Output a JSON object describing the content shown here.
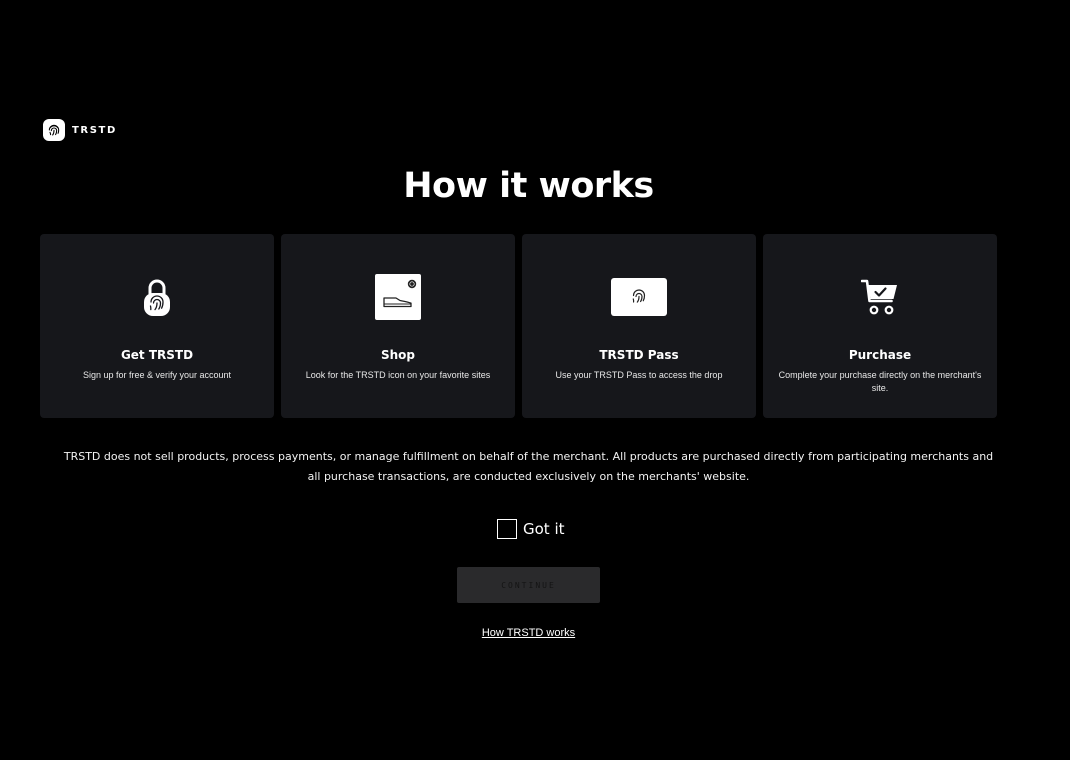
{
  "brand": {
    "name": "TRSTD",
    "icon": "fingerprint-icon"
  },
  "title": "How it works",
  "cards": [
    {
      "title": "Get TRSTD",
      "desc": "Sign up for free & verify your account",
      "icon": "fingerprint-lock-icon"
    },
    {
      "title": "Shop",
      "desc": "Look for the TRSTD icon on your favorite sites",
      "icon": "product-card-icon"
    },
    {
      "title": "TRSTD Pass",
      "desc": "Use your TRSTD Pass to access the drop",
      "icon": "pass-card-icon"
    },
    {
      "title": "Purchase",
      "desc": "Complete your purchase directly on the merchant's site.",
      "icon": "shopping-cart-check-icon"
    }
  ],
  "disclaimer": "TRSTD does not sell products, process payments, or manage fulfillment on behalf of the merchant. All products are purchased directly from participating merchants and all purchase transactions, are conducted exclusively on the merchants' website.",
  "confirm": {
    "label": "Got it",
    "checked": false
  },
  "continue_label": "CONTINUE",
  "how_link": "How TRSTD works",
  "colors": {
    "background": "#000000",
    "card": "#16171b",
    "button_disabled": "#2a2a2c"
  }
}
